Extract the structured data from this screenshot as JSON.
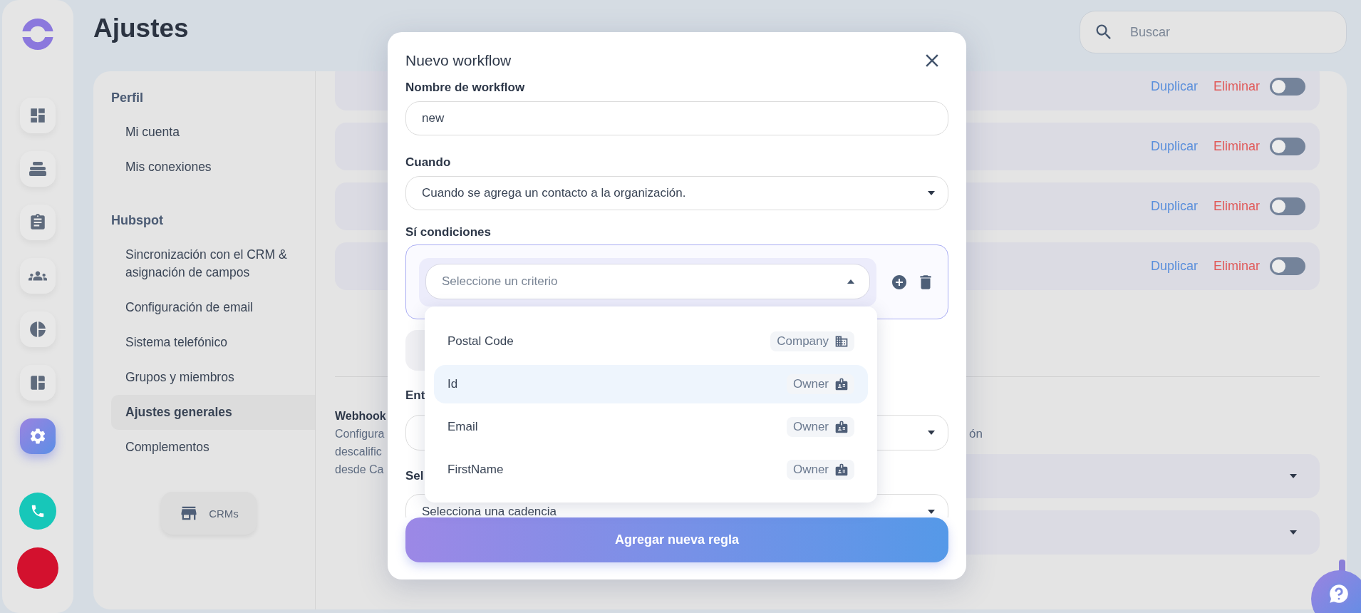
{
  "rail": {
    "items": [
      {
        "selected": false
      },
      {
        "selected": false
      },
      {
        "selected": false
      },
      {
        "selected": false
      },
      {
        "selected": false
      },
      {
        "selected": false
      },
      {
        "selected": true
      }
    ]
  },
  "page_title": "Ajustes",
  "search": {
    "placeholder": "Buscar"
  },
  "settings_nav": {
    "sections": [
      {
        "title": "Perfil",
        "items": [
          {
            "label": "Mi cuenta",
            "selected": false
          },
          {
            "label": "Mis conexiones",
            "selected": false
          }
        ]
      },
      {
        "title": "Hubspot",
        "items": [
          {
            "label": "Sincronización con el CRM & asignación de campos",
            "selected": false
          },
          {
            "label": "Configuración de email",
            "selected": false
          },
          {
            "label": "Sistema telefónico",
            "selected": false
          },
          {
            "label": "Grupos y miembros",
            "selected": false
          },
          {
            "label": "Ajustes generales",
            "selected": true
          },
          {
            "label": "Complementos",
            "selected": false
          }
        ]
      }
    ],
    "crm_button": "CRMs"
  },
  "workflows": [
    {
      "duplicate": "Duplicar",
      "delete": "Eliminar",
      "on": false
    },
    {
      "duplicate": "Duplicar",
      "delete": "Eliminar",
      "on": false
    },
    {
      "duplicate": "Duplicar",
      "delete": "Eliminar",
      "on": false
    },
    {
      "duplicate": "Duplicar",
      "delete": "Eliminar",
      "on": false
    }
  ],
  "general_settings": {
    "title": "Webhook",
    "description_lines": [
      "Configura",
      "descalific",
      "desde Ca"
    ],
    "right_text": "ón"
  },
  "modal": {
    "title": "Nuevo workflow",
    "fields": [
      {
        "kind": "input",
        "label": "Nombre de workflow",
        "value": "new"
      },
      {
        "kind": "select",
        "label": "Cuando",
        "value": "Cuando se agrega un contacto a la organización."
      }
    ],
    "conditions": {
      "label": "Sí condiciones",
      "placeholder": "Seleccione un criterio",
      "expanded": true
    },
    "criterion_options": [
      {
        "label": "Postal Code",
        "tag": "Company",
        "kind": "company",
        "selected": false
      },
      {
        "label": "Id",
        "tag": "Owner",
        "kind": "owner",
        "selected": true
      },
      {
        "label": "Email",
        "tag": "Owner",
        "kind": "owner",
        "selected": false
      },
      {
        "label": "FirstName",
        "tag": "Owner",
        "kind": "owner",
        "selected": false
      }
    ],
    "lower_fields": [
      {
        "label": "Ent"
      },
      {
        "label": "Sel",
        "value": "Selecciona una cadencia"
      }
    ],
    "submit": "Agregar nueva regla"
  }
}
